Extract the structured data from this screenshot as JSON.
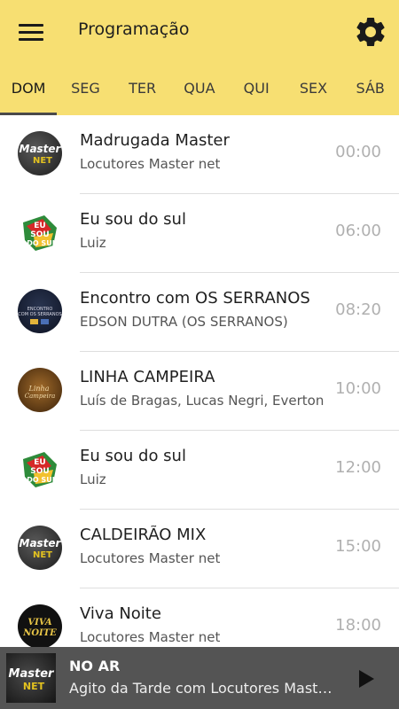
{
  "header": {
    "title": "Programação",
    "menu_icon": "menu-icon",
    "settings_icon": "gear-icon",
    "background": "#f7df72"
  },
  "tabs": [
    {
      "label": "DOM",
      "active": true
    },
    {
      "label": "SEG",
      "active": false
    },
    {
      "label": "TER",
      "active": false
    },
    {
      "label": "QUA",
      "active": false
    },
    {
      "label": "QUI",
      "active": false
    },
    {
      "label": "SEX",
      "active": false
    },
    {
      "label": "SÁB",
      "active": false
    }
  ],
  "programs": [
    {
      "title": "Madrugada Master",
      "host": "Locutores Master net",
      "time": "00:00",
      "logo": "master-net-logo"
    },
    {
      "title": "Eu sou do sul",
      "host": "Luiz",
      "time": "06:00",
      "logo": "eu-sou-do-sul-logo"
    },
    {
      "title": "Encontro com OS SERRANOS",
      "host": "EDSON DUTRA (OS SERRANOS)",
      "time": "08:20",
      "logo": "serranos-logo"
    },
    {
      "title": "LINHA CAMPEIRA",
      "host": "Luís de Bragas, Lucas Negri, Everton",
      "time": "10:00",
      "logo": "linha-campeira-logo"
    },
    {
      "title": "Eu sou do sul",
      "host": "Luiz",
      "time": "12:00",
      "logo": "eu-sou-do-sul-logo"
    },
    {
      "title": "CALDEIRÃO MIX",
      "host": "Locutores Master net",
      "time": "15:00",
      "logo": "master-net-logo"
    },
    {
      "title": "Viva Noite",
      "host": "Locutores Master net",
      "time": "18:00",
      "logo": "viva-noite-logo"
    }
  ],
  "player": {
    "label": "NO AR",
    "now_playing": "Agito da Tarde com Locutores Master net",
    "play_icon": "play-icon"
  }
}
